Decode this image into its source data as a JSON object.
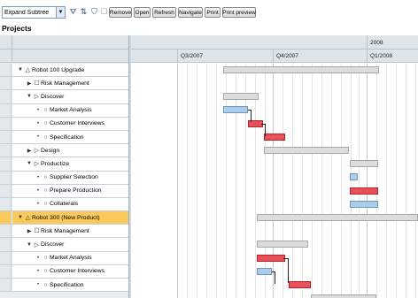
{
  "toolbar": {
    "select_value": "Expand Subtree",
    "buttons": [
      "Remove",
      "Open",
      "Refresh",
      "Navigate",
      "Print",
      "Print preview"
    ],
    "icons": [
      "filter-icon",
      "sort-icon",
      "filter-clear-icon",
      "checkbox-icon"
    ]
  },
  "page_title": "Projects",
  "timeline": {
    "year": "2008",
    "quarters": [
      "Q3/2007",
      "Q4/2007",
      "Q1/2008"
    ]
  },
  "tree_rows": [
    {
      "label": "Robot 100 Upgrade",
      "level": 0,
      "twisty": "open",
      "icon": "warning",
      "highlight": false
    },
    {
      "label": "Risk Management",
      "level": 1,
      "twisty": "closed",
      "icon": "square",
      "highlight": false
    },
    {
      "label": "Discover",
      "level": 1,
      "twisty": "open",
      "icon": "phase",
      "highlight": false
    },
    {
      "label": "Market Analysis",
      "level": 2,
      "twisty": "bullet",
      "icon": "circle",
      "highlight": false
    },
    {
      "label": "Customer Interviews",
      "level": 2,
      "twisty": "bullet",
      "icon": "circle",
      "highlight": false
    },
    {
      "label": "Specification",
      "level": 2,
      "twisty": "bullet",
      "icon": "circle",
      "highlight": false
    },
    {
      "label": "Design",
      "level": 1,
      "twisty": "closed",
      "icon": "phase",
      "highlight": false
    },
    {
      "label": "Productize",
      "level": 1,
      "twisty": "open",
      "icon": "phase",
      "highlight": false
    },
    {
      "label": "Supplier Selection",
      "level": 2,
      "twisty": "bullet",
      "icon": "circle",
      "highlight": false
    },
    {
      "label": "Prepare Production",
      "level": 2,
      "twisty": "bullet",
      "icon": "circle",
      "highlight": false
    },
    {
      "label": "Collaterals",
      "level": 2,
      "twisty": "bullet",
      "icon": "circle",
      "highlight": false
    },
    {
      "label": "Robot 300 (New Product)",
      "level": 0,
      "twisty": "open",
      "icon": "warning",
      "highlight": true
    },
    {
      "label": "Risk Management",
      "level": 1,
      "twisty": "closed",
      "icon": "square",
      "highlight": false
    },
    {
      "label": "Discover",
      "level": 1,
      "twisty": "open",
      "icon": "phase",
      "highlight": false
    },
    {
      "label": "Market Analysis",
      "level": 2,
      "twisty": "bullet",
      "icon": "circle",
      "highlight": false
    },
    {
      "label": "Customer Interviews",
      "level": 2,
      "twisty": "bullet",
      "icon": "circle",
      "highlight": false
    },
    {
      "label": "Specification",
      "level": 2,
      "twisty": "bullet",
      "icon": "circle",
      "highlight": false
    }
  ],
  "colors": {
    "highlight": "#fbc85a",
    "task_late": "#e8505a",
    "task_ok": "#a9cdea",
    "summary": "#dcdcdc"
  }
}
